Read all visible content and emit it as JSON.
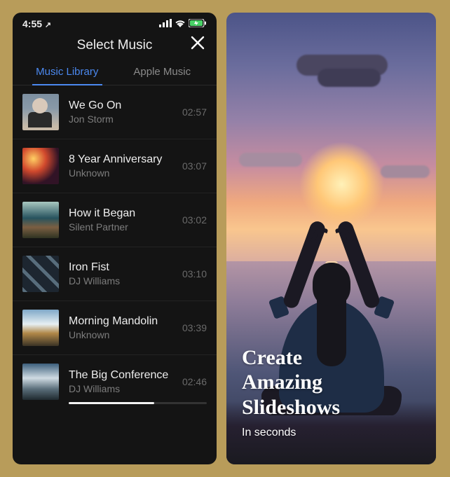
{
  "status_bar": {
    "time": "4:55",
    "location_arrow": "➤",
    "signal": "▪▪▪▪",
    "wifi": "wifi",
    "battery": "battery"
  },
  "header": {
    "title": "Select Music",
    "close": "✕"
  },
  "tabs": [
    {
      "label": "Music Library",
      "active": true
    },
    {
      "label": "Apple Music",
      "active": false
    }
  ],
  "tracks": [
    {
      "title": "We Go On",
      "artist": "Jon Storm",
      "duration": "02:57"
    },
    {
      "title": "8 Year Anniversary",
      "artist": "Unknown",
      "duration": "03:07"
    },
    {
      "title": "How it Began",
      "artist": "Silent Partner",
      "duration": "03:02"
    },
    {
      "title": "Iron Fist",
      "artist": "DJ Williams",
      "duration": "03:10"
    },
    {
      "title": "Morning Mandolin",
      "artist": "Unknown",
      "duration": "03:39"
    },
    {
      "title": "The Big Conference",
      "artist": "DJ Williams",
      "duration": "02:46"
    }
  ],
  "promo": {
    "heading_line1": "Create",
    "heading_line2": "Amazing",
    "heading_line3": "Slideshows",
    "sub": "In seconds"
  }
}
